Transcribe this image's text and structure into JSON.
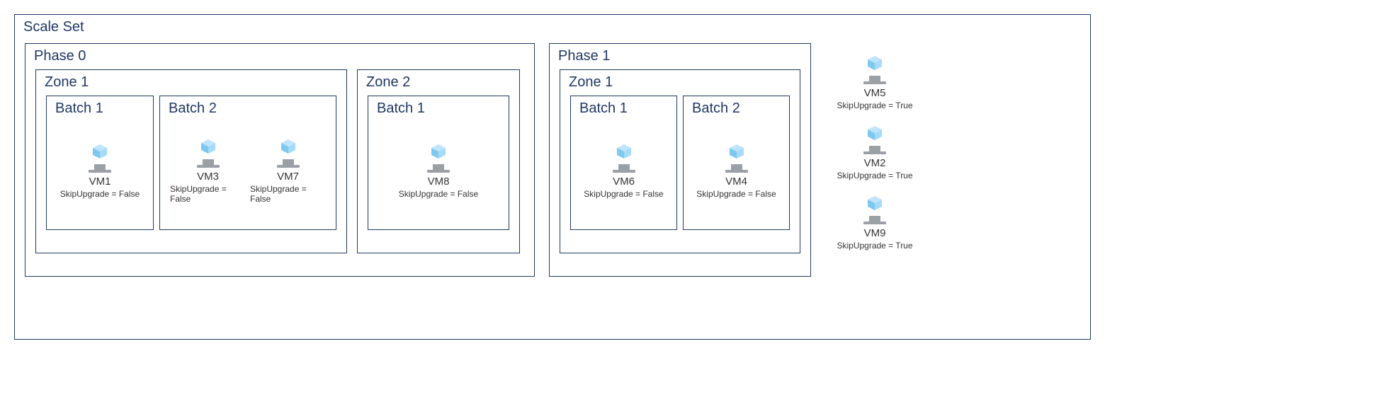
{
  "scaleSet": {
    "title": "Scale Set",
    "phases": [
      {
        "title": "Phase 0",
        "zones": [
          {
            "title": "Zone 1",
            "batches": [
              {
                "title": "Batch 1",
                "vms": [
                  {
                    "name": "VM1",
                    "attr": "SkipUpgrade = False"
                  }
                ]
              },
              {
                "title": "Batch 2",
                "vms": [
                  {
                    "name": "VM3",
                    "attr": "SkipUpgrade = False"
                  },
                  {
                    "name": "VM7",
                    "attr": "SkipUpgrade = False"
                  }
                ]
              }
            ]
          },
          {
            "title": "Zone 2",
            "batches": [
              {
                "title": "Batch 1",
                "vms": [
                  {
                    "name": "VM8",
                    "attr": "SkipUpgrade = False"
                  }
                ]
              }
            ]
          }
        ]
      },
      {
        "title": "Phase 1",
        "zones": [
          {
            "title": "Zone 1",
            "batches": [
              {
                "title": "Batch 1",
                "vms": [
                  {
                    "name": "VM6",
                    "attr": "SkipUpgrade = False"
                  }
                ]
              },
              {
                "title": "Batch 2",
                "vms": [
                  {
                    "name": "VM4",
                    "attr": "SkipUpgrade = False"
                  }
                ]
              }
            ]
          }
        ]
      }
    ],
    "sideVms": [
      {
        "name": "VM5",
        "attr": "SkipUpgrade = True"
      },
      {
        "name": "VM2",
        "attr": "SkipUpgrade = True"
      },
      {
        "name": "VM9",
        "attr": "SkipUpgrade = True"
      }
    ]
  }
}
